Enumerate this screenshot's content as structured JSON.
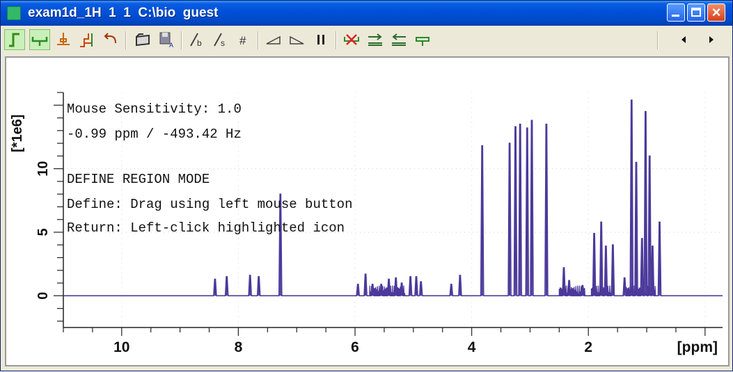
{
  "window": {
    "title": "exam1d_1H  1  1  C:\\bio  guest",
    "buttons": [
      "minimize",
      "maximize",
      "close"
    ]
  },
  "toolbar": {
    "icons": [
      "peak-mode-icon",
      "define-region-icon",
      "baseline-icon",
      "integral-icon",
      "undo-icon",
      "open-region-icon",
      "save-region-icon",
      "integral-bias-icon",
      "integral-slope-icon",
      "grid-icon",
      "slope-left-icon",
      "slope-right-icon",
      "pause-icon",
      "delete-region-icon",
      "move-right-icon",
      "move-left-icon",
      "calibrate-icon",
      "scroll-left-icon",
      "scroll-right-icon"
    ]
  },
  "overlay": {
    "line1": "Mouse Sensitivity: 1.0",
    "line2": "-0.99 ppm / -493.42 Hz",
    "line3": "DEFINE REGION MODE",
    "line4": "Define: Drag using left mouse button",
    "line5": "Return: Left-click highlighted icon"
  },
  "axes": {
    "y_unit": "[*1e6]",
    "y_ticks": [
      "0",
      "5",
      "10"
    ],
    "x_ticks": [
      "10",
      "8",
      "6",
      "4",
      "2"
    ],
    "x_unit": "[ppm]"
  },
  "chart_data": {
    "type": "line",
    "xlabel": "[ppm]",
    "ylabel": "[*1e6]",
    "xlim": [
      11.0,
      -0.3
    ],
    "ylim": [
      -2.5,
      16
    ],
    "x_reversed": true,
    "color": "#4B3A9A",
    "peaks": [
      {
        "x": 8.4,
        "y": 1.3
      },
      {
        "x": 8.2,
        "y": 1.5
      },
      {
        "x": 7.8,
        "y": 1.6
      },
      {
        "x": 7.65,
        "y": 1.5
      },
      {
        "x": 7.28,
        "y": 8.0
      },
      {
        "x": 5.95,
        "y": 0.9
      },
      {
        "x": 5.82,
        "y": 1.7
      },
      {
        "x": 5.7,
        "y": 0.9
      },
      {
        "x": 5.55,
        "y": 0.9
      },
      {
        "x": 5.42,
        "y": 1.3
      },
      {
        "x": 5.3,
        "y": 1.4
      },
      {
        "x": 5.2,
        "y": 1.0
      },
      {
        "x": 5.05,
        "y": 1.5
      },
      {
        "x": 4.95,
        "y": 1.5
      },
      {
        "x": 4.87,
        "y": 1.1
      },
      {
        "x": 4.35,
        "y": 0.9
      },
      {
        "x": 4.2,
        "y": 1.6
      },
      {
        "x": 3.82,
        "y": 11.8
      },
      {
        "x": 3.35,
        "y": 12.0
      },
      {
        "x": 3.25,
        "y": 13.3
      },
      {
        "x": 3.17,
        "y": 13.5
      },
      {
        "x": 3.05,
        "y": 13.2
      },
      {
        "x": 2.97,
        "y": 13.8
      },
      {
        "x": 2.72,
        "y": 13.5
      },
      {
        "x": 2.42,
        "y": 2.2
      },
      {
        "x": 2.33,
        "y": 1.2
      },
      {
        "x": 2.1,
        "y": 0.8
      },
      {
        "x": 1.9,
        "y": 4.9
      },
      {
        "x": 1.78,
        "y": 5.8
      },
      {
        "x": 1.7,
        "y": 3.9
      },
      {
        "x": 1.58,
        "y": 4.0
      },
      {
        "x": 1.38,
        "y": 1.4
      },
      {
        "x": 1.26,
        "y": 15.4
      },
      {
        "x": 1.18,
        "y": 10.5
      },
      {
        "x": 1.08,
        "y": 4.5
      },
      {
        "x": 1.02,
        "y": 14.5
      },
      {
        "x": 0.95,
        "y": 11.0
      },
      {
        "x": 0.9,
        "y": 3.9
      },
      {
        "x": 0.78,
        "y": 5.8
      }
    ]
  }
}
